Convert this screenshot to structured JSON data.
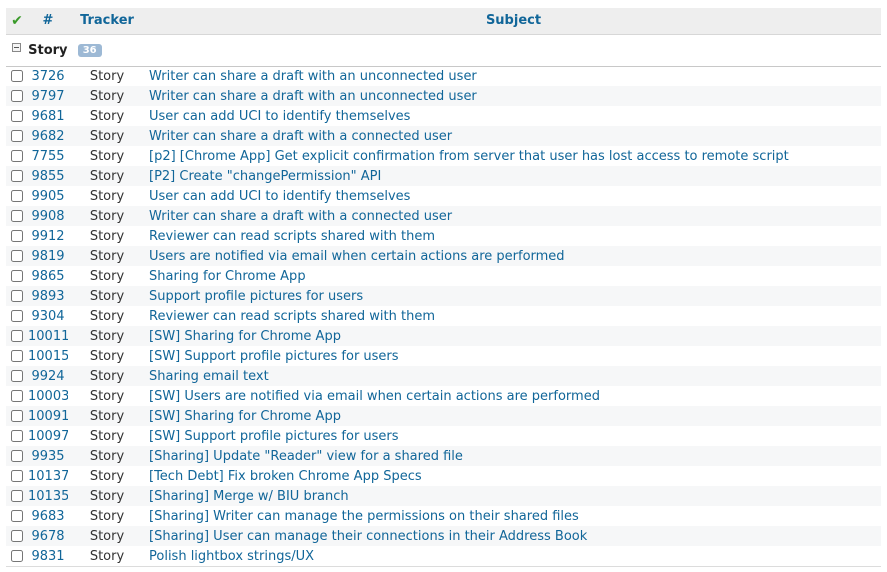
{
  "header": {
    "check_glyph": "✔",
    "id_label": "#",
    "tracker_label": "Tracker",
    "subject_label": "Subject"
  },
  "group": {
    "name": "Story",
    "count": "36"
  },
  "issues": [
    {
      "id": "3726",
      "tracker": "Story",
      "subject": "Writer can share a draft with an unconnected user"
    },
    {
      "id": "9797",
      "tracker": "Story",
      "subject": "Writer can share a draft with an unconnected user"
    },
    {
      "id": "9681",
      "tracker": "Story",
      "subject": "User can add UCI to identify themselves"
    },
    {
      "id": "9682",
      "tracker": "Story",
      "subject": "Writer can share a draft with a connected user"
    },
    {
      "id": "7755",
      "tracker": "Story",
      "subject": "[p2] [Chrome App] Get explicit confirmation from server that user has lost access to remote script"
    },
    {
      "id": "9855",
      "tracker": "Story",
      "subject": "[P2] Create \"changePermission\" API"
    },
    {
      "id": "9905",
      "tracker": "Story",
      "subject": "User can add UCI to identify themselves"
    },
    {
      "id": "9908",
      "tracker": "Story",
      "subject": "Writer can share a draft with a connected user"
    },
    {
      "id": "9912",
      "tracker": "Story",
      "subject": "Reviewer can read scripts shared with them"
    },
    {
      "id": "9819",
      "tracker": "Story",
      "subject": "Users are notified via email when certain actions are performed"
    },
    {
      "id": "9865",
      "tracker": "Story",
      "subject": "Sharing for Chrome App"
    },
    {
      "id": "9893",
      "tracker": "Story",
      "subject": "Support profile pictures for users"
    },
    {
      "id": "9304",
      "tracker": "Story",
      "subject": "Reviewer can read scripts shared with them"
    },
    {
      "id": "10011",
      "tracker": "Story",
      "subject": "[SW] Sharing for Chrome App"
    },
    {
      "id": "10015",
      "tracker": "Story",
      "subject": "[SW] Support profile pictures for users"
    },
    {
      "id": "9924",
      "tracker": "Story",
      "subject": "Sharing email text"
    },
    {
      "id": "10003",
      "tracker": "Story",
      "subject": "[SW] Users are notified via email when certain actions are performed"
    },
    {
      "id": "10091",
      "tracker": "Story",
      "subject": "[SW] Sharing for Chrome App"
    },
    {
      "id": "10097",
      "tracker": "Story",
      "subject": "[SW] Support profile pictures for users"
    },
    {
      "id": "9935",
      "tracker": "Story",
      "subject": "[Sharing] Update \"Reader\" view for a shared file"
    },
    {
      "id": "10137",
      "tracker": "Story",
      "subject": "[Tech Debt] Fix broken Chrome App Specs"
    },
    {
      "id": "10135",
      "tracker": "Story",
      "subject": "[Sharing] Merge w/ BIU branch"
    },
    {
      "id": "9683",
      "tracker": "Story",
      "subject": "[Sharing] Writer can manage the permissions on their shared files"
    },
    {
      "id": "9678",
      "tracker": "Story",
      "subject": "[Sharing] User can manage their connections in their Address Book"
    },
    {
      "id": "9831",
      "tracker": "Story",
      "subject": "Polish lightbox strings/UX"
    }
  ]
}
